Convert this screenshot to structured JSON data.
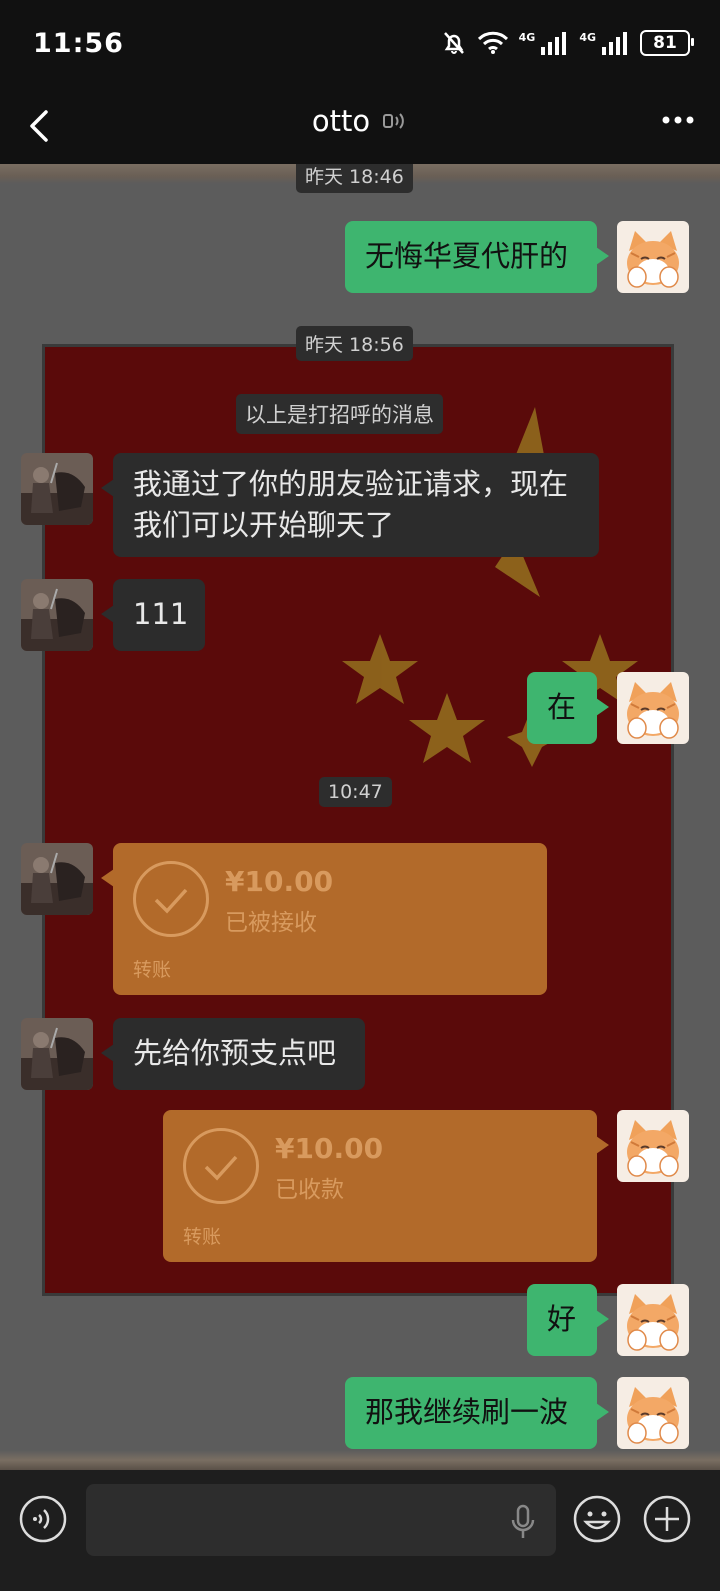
{
  "status": {
    "time": "11:56",
    "net1": "4G",
    "net2": "4G",
    "battery": "81"
  },
  "header": {
    "title": "otto"
  },
  "messages": {
    "ts1": "昨天 18:46",
    "m1": "无悔华夏代肝的",
    "ts2": "昨天 18:56",
    "system": "以上是打招呼的消息",
    "m2_line1": "我通过了你的朋友验证请求，现在",
    "m2_line2": "我们可以开始聊天了",
    "m3": "111",
    "m4": "在",
    "ts3": "10:47",
    "transfer1": {
      "amount": "¥10.00",
      "status": "已被接收",
      "label": "转账"
    },
    "m5": "先给你预支点吧",
    "transfer2": {
      "amount": "¥10.00",
      "status": "已收款",
      "label": "转账"
    },
    "m6": "好",
    "m7": "那我继续刷一波"
  },
  "colors": {
    "my_bubble": "#3eb56f",
    "other_bubble": "#2c2c2c",
    "transfer": "#b26a2a",
    "flag_red": "#5a0a0a",
    "star": "#b5a82a"
  },
  "icons": [
    "back-icon",
    "voice-call-icon",
    "more-icon",
    "voice-input-icon",
    "mic-icon",
    "emoji-icon",
    "plus-icon",
    "mute-bell-icon",
    "wifi-icon",
    "signal-icon"
  ]
}
